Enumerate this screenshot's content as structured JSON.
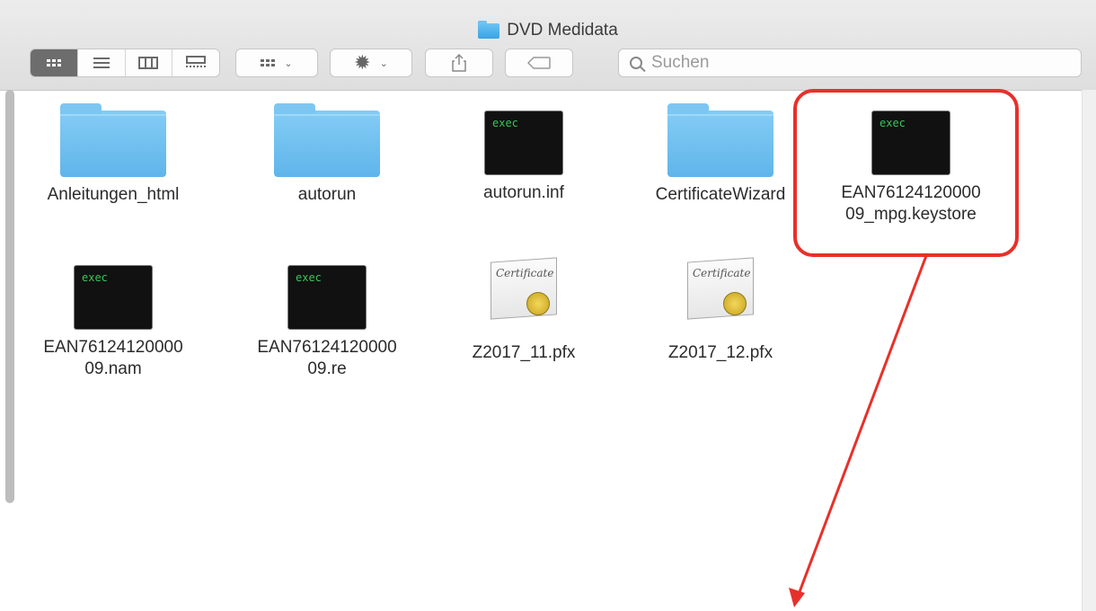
{
  "window": {
    "title": "DVD Medidata"
  },
  "toolbar": {
    "view_modes": [
      "icon-view",
      "list-view",
      "column-view",
      "gallery-view"
    ],
    "search_placeholder": "Suchen"
  },
  "files": [
    {
      "name": "Anleitungen_html",
      "type": "folder"
    },
    {
      "name": "autorun",
      "type": "folder"
    },
    {
      "name": "autorun.inf",
      "type": "exec",
      "badge": "exec"
    },
    {
      "name": "CertificateWizard",
      "type": "folder"
    },
    {
      "name": "EAN76124120000\n09_mpg.keystore",
      "type": "exec",
      "badge": "exec"
    },
    {
      "name": "EAN76124120000\n09.nam",
      "type": "exec",
      "badge": "exec"
    },
    {
      "name": "EAN76124120000\n09.re",
      "type": "exec",
      "badge": "exec"
    },
    {
      "name": "Z2017_11.pfx",
      "type": "certificate",
      "badge": "Certificate"
    },
    {
      "name": "Z2017_12.pfx",
      "type": "certificate",
      "badge": "Certificate"
    }
  ],
  "annotation": {
    "highlight_color": "#e8302a"
  }
}
